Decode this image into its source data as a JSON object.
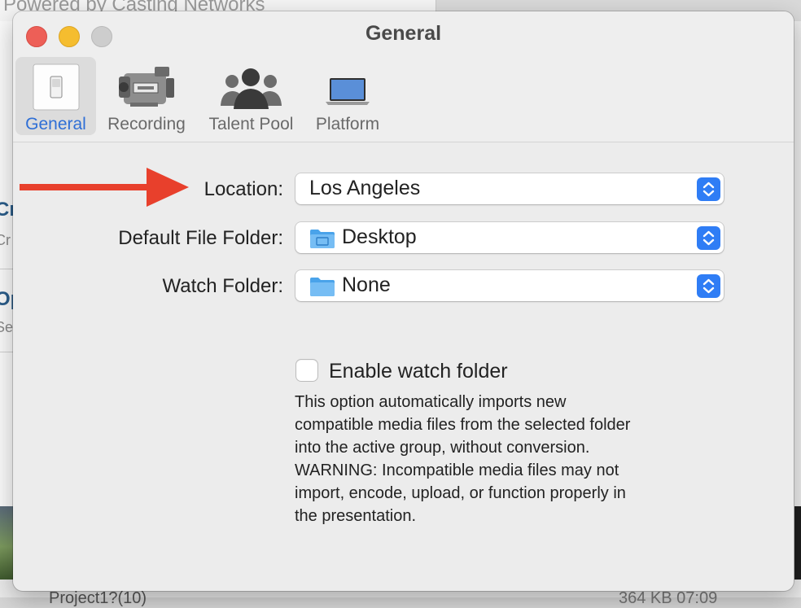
{
  "background_app": {
    "powered_text": "Powered by Casting Networks",
    "left_item_1_title": "Cr",
    "left_item_1_sub": "Cr",
    "left_item_2_title": "Op",
    "left_item_2_sub": "Se",
    "bottom_text_left": "Project1?(10)",
    "bottom_text_right": "364 KB    07:09"
  },
  "window": {
    "title": "General",
    "traffic_lights": [
      "close",
      "minimize",
      "zoom"
    ]
  },
  "toolbar": {
    "tabs": [
      {
        "label": "General",
        "icon": "light-switch-icon",
        "selected": true
      },
      {
        "label": "Recording",
        "icon": "video-camera-icon",
        "selected": false
      },
      {
        "label": "Talent Pool",
        "icon": "people-group-icon",
        "selected": false
      },
      {
        "label": "Platform",
        "icon": "laptop-icon",
        "selected": false
      }
    ]
  },
  "form": {
    "location": {
      "label": "Location:",
      "value": "Los Angeles"
    },
    "default_folder": {
      "label": "Default File Folder:",
      "value": "Desktop",
      "icon": "desktop-folder-icon"
    },
    "watch_folder": {
      "label": "Watch Folder:",
      "value": "None",
      "icon": "folder-icon"
    },
    "enable_watch": {
      "label": "Enable watch folder",
      "checked": false
    },
    "description_lines": [
      "This option automatically imports new",
      "compatible media files from the selected folder",
      "into the active group, without conversion.",
      "WARNING: Incompatible media files may not",
      "import, encode, upload, or function properly in",
      "the presentation."
    ]
  },
  "colors": {
    "accent": "#2f7df5",
    "selected_tab_label": "#2f6fd6",
    "arrow": "#e8402c",
    "close": "#ed5f57",
    "minimize": "#f5bd2f",
    "zoom_inactive": "#cdcdcd"
  }
}
